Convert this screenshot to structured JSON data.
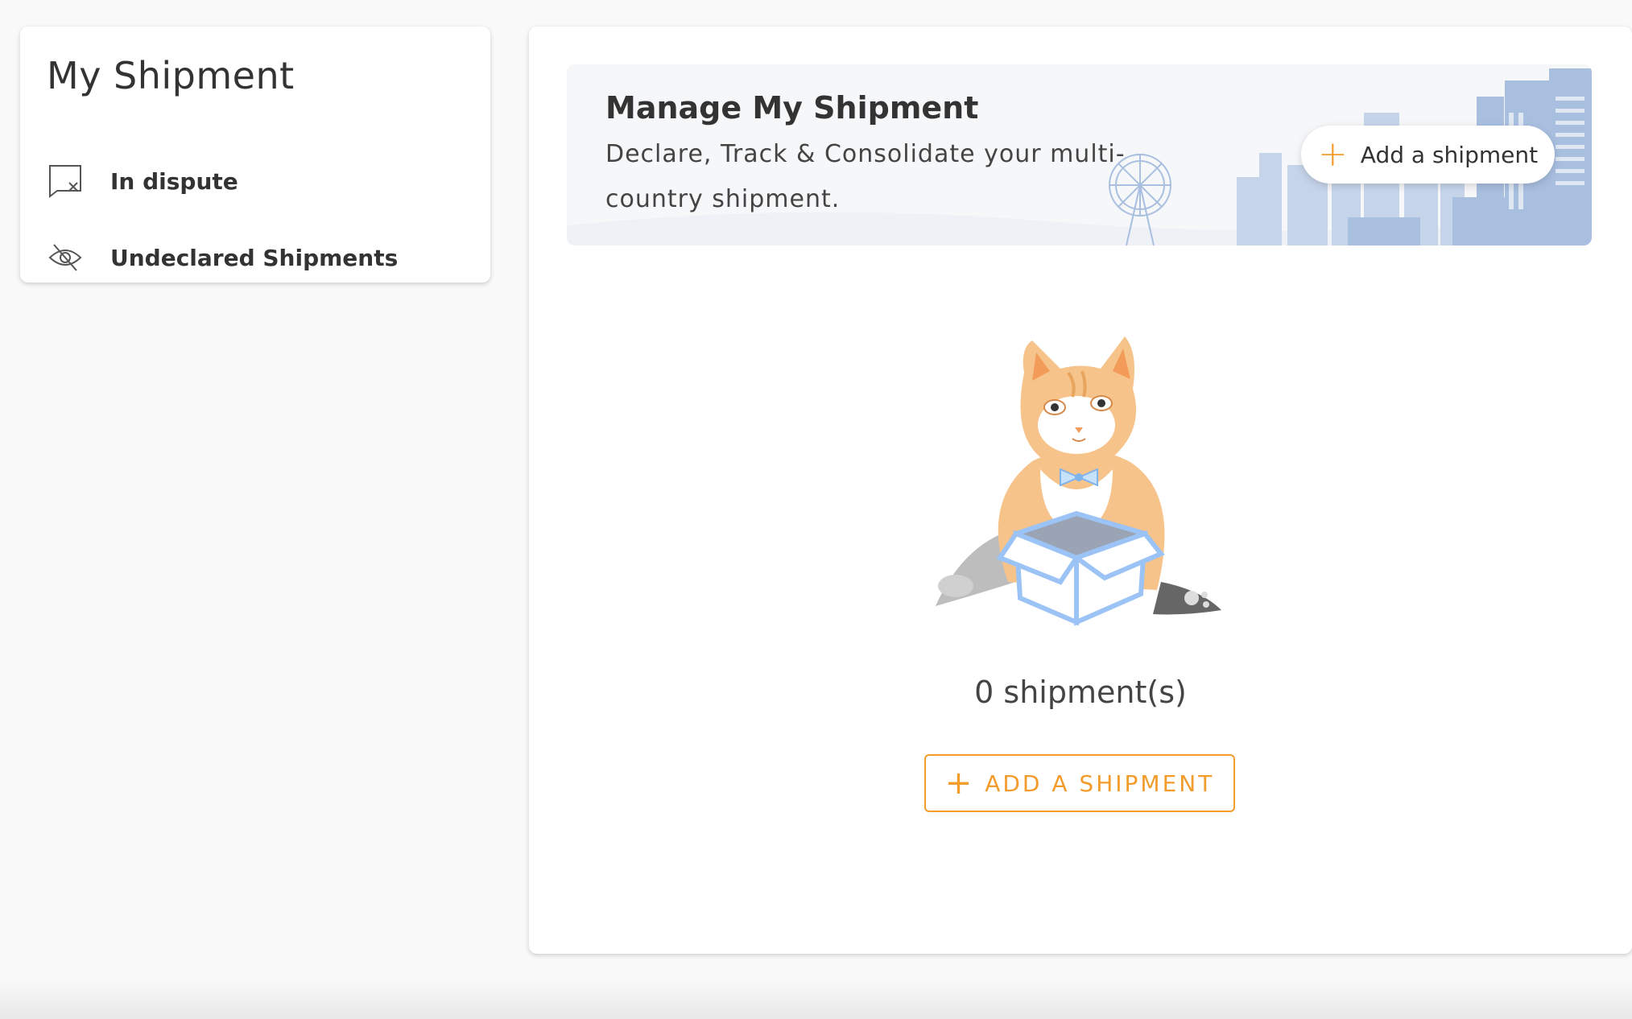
{
  "sidebar": {
    "title": "My Shipment",
    "items": [
      {
        "label": "In dispute",
        "icon": "dispute-icon"
      },
      {
        "label": "Undeclared Shipments",
        "icon": "eye-off-icon"
      }
    ]
  },
  "banner": {
    "title": "Manage My Shipment",
    "description": "Declare, Track & Consolidate your multi-country shipment.",
    "button_label": "Add a shipment"
  },
  "empty_state": {
    "count_text": "0 shipment(s)",
    "button_label": "ADD A SHIPMENT"
  },
  "colors": {
    "accent": "#f39c2c",
    "city": "#a9bfe0",
    "box": "#9cc3f5"
  }
}
